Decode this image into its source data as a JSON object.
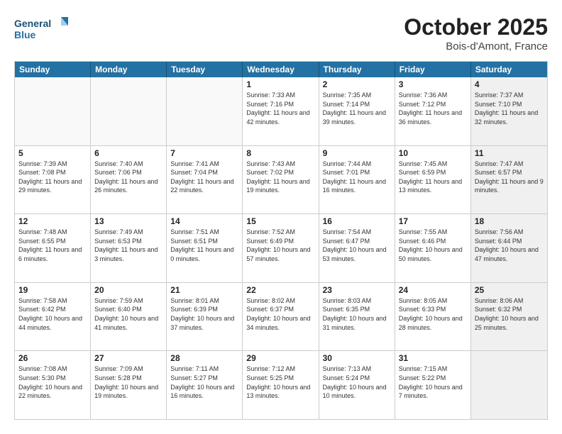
{
  "logo": {
    "line1": "General",
    "line2": "Blue"
  },
  "title": "October 2025",
  "subtitle": "Bois-d'Amont, France",
  "days_of_week": [
    "Sunday",
    "Monday",
    "Tuesday",
    "Wednesday",
    "Thursday",
    "Friday",
    "Saturday"
  ],
  "weeks": [
    [
      {
        "day": "",
        "info": "",
        "empty": true
      },
      {
        "day": "",
        "info": "",
        "empty": true
      },
      {
        "day": "",
        "info": "",
        "empty": true
      },
      {
        "day": "1",
        "info": "Sunrise: 7:33 AM\nSunset: 7:16 PM\nDaylight: 11 hours\nand 42 minutes."
      },
      {
        "day": "2",
        "info": "Sunrise: 7:35 AM\nSunset: 7:14 PM\nDaylight: 11 hours\nand 39 minutes."
      },
      {
        "day": "3",
        "info": "Sunrise: 7:36 AM\nSunset: 7:12 PM\nDaylight: 11 hours\nand 36 minutes."
      },
      {
        "day": "4",
        "info": "Sunrise: 7:37 AM\nSunset: 7:10 PM\nDaylight: 11 hours\nand 32 minutes.",
        "shaded": true
      }
    ],
    [
      {
        "day": "5",
        "info": "Sunrise: 7:39 AM\nSunset: 7:08 PM\nDaylight: 11 hours\nand 29 minutes."
      },
      {
        "day": "6",
        "info": "Sunrise: 7:40 AM\nSunset: 7:06 PM\nDaylight: 11 hours\nand 26 minutes."
      },
      {
        "day": "7",
        "info": "Sunrise: 7:41 AM\nSunset: 7:04 PM\nDaylight: 11 hours\nand 22 minutes."
      },
      {
        "day": "8",
        "info": "Sunrise: 7:43 AM\nSunset: 7:02 PM\nDaylight: 11 hours\nand 19 minutes."
      },
      {
        "day": "9",
        "info": "Sunrise: 7:44 AM\nSunset: 7:01 PM\nDaylight: 11 hours\nand 16 minutes."
      },
      {
        "day": "10",
        "info": "Sunrise: 7:45 AM\nSunset: 6:59 PM\nDaylight: 11 hours\nand 13 minutes."
      },
      {
        "day": "11",
        "info": "Sunrise: 7:47 AM\nSunset: 6:57 PM\nDaylight: 11 hours\nand 9 minutes.",
        "shaded": true
      }
    ],
    [
      {
        "day": "12",
        "info": "Sunrise: 7:48 AM\nSunset: 6:55 PM\nDaylight: 11 hours\nand 6 minutes."
      },
      {
        "day": "13",
        "info": "Sunrise: 7:49 AM\nSunset: 6:53 PM\nDaylight: 11 hours\nand 3 minutes."
      },
      {
        "day": "14",
        "info": "Sunrise: 7:51 AM\nSunset: 6:51 PM\nDaylight: 11 hours\nand 0 minutes."
      },
      {
        "day": "15",
        "info": "Sunrise: 7:52 AM\nSunset: 6:49 PM\nDaylight: 10 hours\nand 57 minutes."
      },
      {
        "day": "16",
        "info": "Sunrise: 7:54 AM\nSunset: 6:47 PM\nDaylight: 10 hours\nand 53 minutes."
      },
      {
        "day": "17",
        "info": "Sunrise: 7:55 AM\nSunset: 6:46 PM\nDaylight: 10 hours\nand 50 minutes."
      },
      {
        "day": "18",
        "info": "Sunrise: 7:56 AM\nSunset: 6:44 PM\nDaylight: 10 hours\nand 47 minutes.",
        "shaded": true
      }
    ],
    [
      {
        "day": "19",
        "info": "Sunrise: 7:58 AM\nSunset: 6:42 PM\nDaylight: 10 hours\nand 44 minutes."
      },
      {
        "day": "20",
        "info": "Sunrise: 7:59 AM\nSunset: 6:40 PM\nDaylight: 10 hours\nand 41 minutes."
      },
      {
        "day": "21",
        "info": "Sunrise: 8:01 AM\nSunset: 6:39 PM\nDaylight: 10 hours\nand 37 minutes."
      },
      {
        "day": "22",
        "info": "Sunrise: 8:02 AM\nSunset: 6:37 PM\nDaylight: 10 hours\nand 34 minutes."
      },
      {
        "day": "23",
        "info": "Sunrise: 8:03 AM\nSunset: 6:35 PM\nDaylight: 10 hours\nand 31 minutes."
      },
      {
        "day": "24",
        "info": "Sunrise: 8:05 AM\nSunset: 6:33 PM\nDaylight: 10 hours\nand 28 minutes."
      },
      {
        "day": "25",
        "info": "Sunrise: 8:06 AM\nSunset: 6:32 PM\nDaylight: 10 hours\nand 25 minutes.",
        "shaded": true
      }
    ],
    [
      {
        "day": "26",
        "info": "Sunrise: 7:08 AM\nSunset: 5:30 PM\nDaylight: 10 hours\nand 22 minutes."
      },
      {
        "day": "27",
        "info": "Sunrise: 7:09 AM\nSunset: 5:28 PM\nDaylight: 10 hours\nand 19 minutes."
      },
      {
        "day": "28",
        "info": "Sunrise: 7:11 AM\nSunset: 5:27 PM\nDaylight: 10 hours\nand 16 minutes."
      },
      {
        "day": "29",
        "info": "Sunrise: 7:12 AM\nSunset: 5:25 PM\nDaylight: 10 hours\nand 13 minutes."
      },
      {
        "day": "30",
        "info": "Sunrise: 7:13 AM\nSunset: 5:24 PM\nDaylight: 10 hours\nand 10 minutes."
      },
      {
        "day": "31",
        "info": "Sunrise: 7:15 AM\nSunset: 5:22 PM\nDaylight: 10 hours\nand 7 minutes."
      },
      {
        "day": "",
        "info": "",
        "empty": true,
        "shaded": true
      }
    ]
  ]
}
